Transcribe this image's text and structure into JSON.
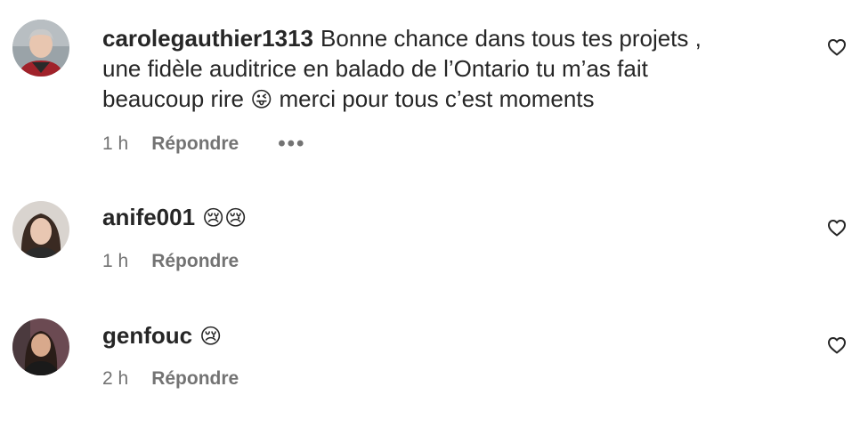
{
  "comments": [
    {
      "username": "carolegauthier1313",
      "text_line1": "Bonne chance dans tous tes projets ,",
      "text_line2": "une fidèle auditrice en balado de l’Ontario tu m’as fait",
      "text_line3a": "beaucoup rire ",
      "emoji": "😜",
      "text_line3b": " merci pour tous c’est moments",
      "time": "1 h",
      "reply_label": "Répondre",
      "more_label": "•••"
    },
    {
      "username": "anife001",
      "emoji": "😢😢",
      "time": "1 h",
      "reply_label": "Répondre"
    },
    {
      "username": "genfouc",
      "emoji": "😢",
      "time": "2 h",
      "reply_label": "Répondre"
    }
  ],
  "icons": {
    "like": "heart-outline-icon",
    "more": "more-horizontal-icon"
  },
  "colors": {
    "text": "#262626",
    "secondary": "#737373",
    "background": "#ffffff"
  }
}
